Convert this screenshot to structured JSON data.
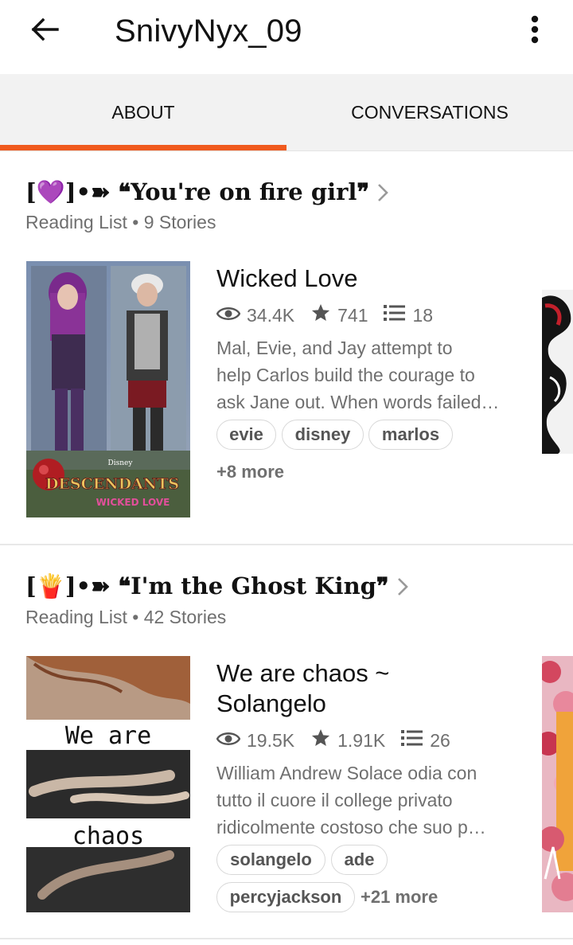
{
  "header": {
    "title": "SnivyNyx_09",
    "back_icon": "arrow-left-icon",
    "menu_icon": "more-vertical-icon"
  },
  "tabs": [
    {
      "label": "ABOUT"
    },
    {
      "label": "CONVERSATIONS"
    }
  ],
  "active_tab": "ABOUT",
  "accent_color": "#f05a1e",
  "reading_lists": [
    {
      "title": "[💜]•➽ ❝You're on fire girl❞",
      "subtitle": "Reading List • 9 Stories",
      "story": {
        "title": "Wicked Love",
        "views": "34.4K",
        "votes": "741",
        "parts": "18",
        "description_lines": [
          "Mal, Evie, and Jay attempt to",
          "help Carlos build the courage to",
          "ask Jane out. When words failed…"
        ],
        "tags": [
          "evie",
          "disney",
          "marlos"
        ],
        "more_tags": "+8 more",
        "cover": {
          "brand": "Disney",
          "title": "DESCENDANTS",
          "subtitle": "WICKED LOVE"
        }
      }
    },
    {
      "title": "[🍟]•➽ ❝I'm the Ghost King❞",
      "subtitle": "Reading List • 42 Stories",
      "story": {
        "title_lines": [
          "We are chaos ~",
          "Solangelo"
        ],
        "views": "19.5K",
        "votes": "1.91K",
        "parts": "26",
        "description_lines": [
          "William Andrew Solace odia con",
          "tutto il cuore il college privato",
          "ridicolmente costoso che suo p…"
        ],
        "tags": [
          "solangelo",
          "ade",
          "percyjackson"
        ],
        "more_tags": "+21 more",
        "cover": {
          "text_top": "We are",
          "text_bottom": "chaos"
        }
      }
    }
  ]
}
